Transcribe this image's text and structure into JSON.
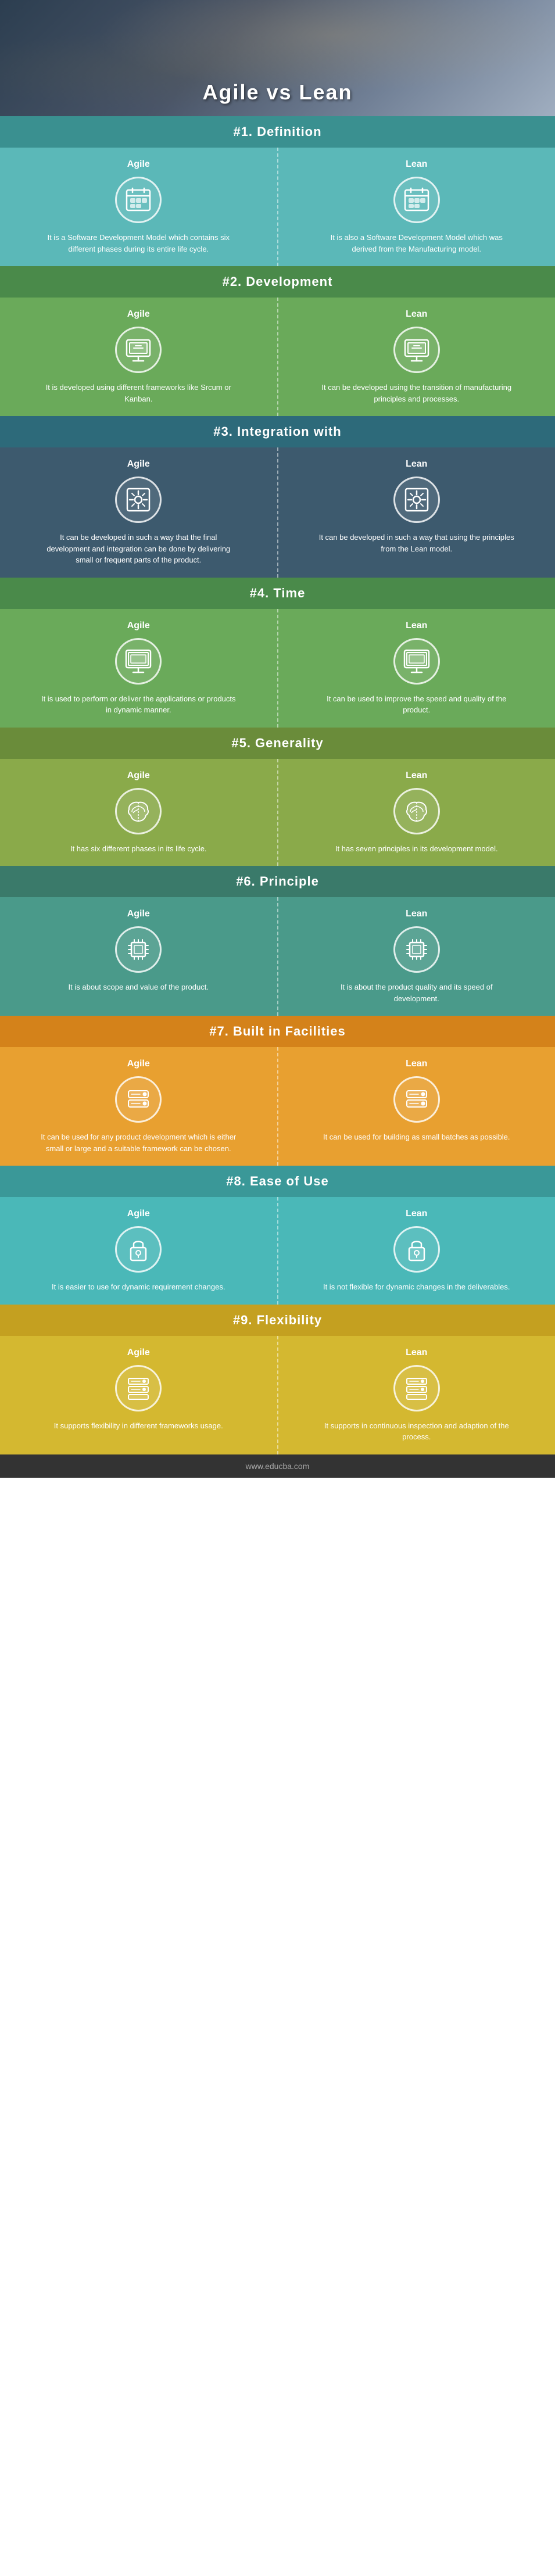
{
  "title": "Agile vs Lean",
  "footer": "www.educba.com",
  "sections": [
    {
      "id": "definition",
      "number": "#1. Definition",
      "headerClass": "teal",
      "bgClass": "bg-teal",
      "agile": {
        "label": "Agile",
        "text": "It is a Software Development Model which contains six different phases during its entire life cycle.",
        "icon": "calendar"
      },
      "lean": {
        "label": "Lean",
        "text": "It is also a Software Development Model which was derived from the Manufacturing model.",
        "icon": "calendar"
      }
    },
    {
      "id": "development",
      "number": "#2. Development",
      "headerClass": "green",
      "bgClass": "bg-green",
      "agile": {
        "label": "Agile",
        "text": "It is developed using different frameworks like Srcum or Kanban.",
        "icon": "monitor"
      },
      "lean": {
        "label": "Lean",
        "text": "It can be developed using the transition of manufacturing principles and processes.",
        "icon": "monitor"
      }
    },
    {
      "id": "integration",
      "number": "#3. Integration with",
      "headerClass": "dark-teal",
      "bgClass": "bg-dark",
      "agile": {
        "label": "Agile",
        "text": "It can be developed in such a way that the final development and integration can be done by delivering small or frequent parts of the product.",
        "icon": "gear"
      },
      "lean": {
        "label": "Lean",
        "text": "It can be developed in such a way that using the principles from the Lean model.",
        "icon": "gear"
      }
    },
    {
      "id": "time",
      "number": "#4. Time",
      "headerClass": "green",
      "bgClass": "bg-green",
      "agile": {
        "label": "Agile",
        "text": "It is used to perform or deliver the applications or products in dynamic manner.",
        "icon": "desktop"
      },
      "lean": {
        "label": "Lean",
        "text": "It can be used to improve the speed and quality of the product.",
        "icon": "desktop"
      }
    },
    {
      "id": "generality",
      "number": "#5. Generality",
      "headerClass": "olive",
      "bgClass": "bg-olive",
      "agile": {
        "label": "Agile",
        "text": "It has six different phases in its life cycle.",
        "icon": "brain"
      },
      "lean": {
        "label": "Lean",
        "text": "It has seven principles in its development model.",
        "icon": "brain"
      }
    },
    {
      "id": "principle",
      "number": "#6. Principle",
      "headerClass": "blue-green",
      "bgClass": "bg-blue-green",
      "agile": {
        "label": "Agile",
        "text": "It is about scope and value of the product.",
        "icon": "chip"
      },
      "lean": {
        "label": "Lean",
        "text": "It is about the product quality and its speed of development.",
        "icon": "chip"
      }
    },
    {
      "id": "facilities",
      "number": "#7. Built in Facilities",
      "headerClass": "orange",
      "bgClass": "bg-orange",
      "agile": {
        "label": "Agile",
        "text": "It can be used for any product development which is either small or large and a suitable framework can be chosen.",
        "icon": "server"
      },
      "lean": {
        "label": "Lean",
        "text": "It can be used for building as small batches as possible.",
        "icon": "server"
      }
    },
    {
      "id": "ease",
      "number": "#8. Ease of Use",
      "headerClass": "teal2",
      "bgClass": "bg-teal2",
      "agile": {
        "label": "Agile",
        "text": "It is easier to use for dynamic requirement changes.",
        "icon": "lock"
      },
      "lean": {
        "label": "Lean",
        "text": "It is not flexible for dynamic changes in the deliverables.",
        "icon": "lock"
      }
    },
    {
      "id": "flexibility",
      "number": "#9. Flexibility",
      "headerClass": "gold",
      "bgClass": "bg-gold",
      "agile": {
        "label": "Agile",
        "text": "It supports flexibility in different frameworks usage.",
        "icon": "server2"
      },
      "lean": {
        "label": "Lean",
        "text": "It supports in continuous inspection and adaption of the process.",
        "icon": "server2"
      }
    }
  ]
}
